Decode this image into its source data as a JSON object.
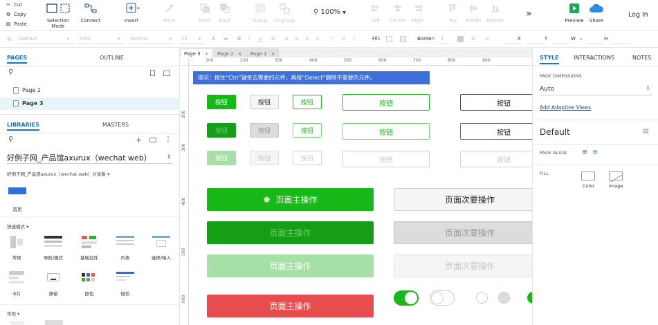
{
  "toolbar": {
    "cut": "Cut",
    "copy": "Copy",
    "paste": "Paste",
    "selection_mode": "Selection Mode",
    "connect": "Connect",
    "insert": "Insert",
    "point": "Point",
    "front": "Front",
    "back": "Back",
    "group": "Group",
    "ungroup": "Ungroup",
    "zoom": "100%",
    "left": "Left",
    "center": "Center",
    "right": "Right",
    "top": "Top",
    "middle": "Middle",
    "bottom": "Bottom",
    "more": "»",
    "preview": "Preview",
    "share": "Share",
    "login": "Log In"
  },
  "format_bar": {
    "style": "Default",
    "font": "Arial",
    "weight": "Normal",
    "size": "13",
    "fill_label": "Fill:",
    "border_label": "Border:",
    "border_value": "1",
    "x_label": "X",
    "y_label": "Y",
    "w_label": "W",
    "h_label": "H"
  },
  "left_panel": {
    "tabs": {
      "pages": "PAGES",
      "outline": "OUTLINE"
    },
    "pages": [
      "Page 2",
      "Page 3"
    ],
    "lib_tabs": {
      "libraries": "LIBRARIES",
      "masters": "MASTERS"
    },
    "library_select": "好例子网_产品馆axurux（wechat web）",
    "library_sub": "好例子网_产品馆axurux（wechat web）分享版",
    "first_item": "首页",
    "group1": "快速模式",
    "items": [
      "常规",
      "导航/模式",
      "基础控件",
      "列表",
      "选择/输入",
      "卡片",
      "弹窗",
      "颜色",
      "微信"
    ],
    "group2": "常规"
  },
  "canvas": {
    "tabs": [
      "Page 3",
      "Page 2",
      "Page 1"
    ],
    "ruler_top": [
      "100",
      "200",
      "300",
      "400",
      "500",
      "600",
      "700",
      "800",
      "900"
    ],
    "ruler_left": [
      "200",
      "300",
      "400",
      "500",
      "600"
    ],
    "tip": "提示：按住“Ctrl”键单击需要的元件，再按“Delect”删除不需要的元件。",
    "btn": "按钮",
    "primary": "页面主操作",
    "secondary": "页面次要操作"
  },
  "right_panel": {
    "tabs": {
      "style": "STYLE",
      "interactions": "INTERACTIONS",
      "notes": "NOTES"
    },
    "page_dimensions": "PAGE DIMENSIONS",
    "auto": "Auto",
    "adaptive": "Add Adaptive Views",
    "default": "Default",
    "page_align": "PAGE ALIGN",
    "fill": "FILL",
    "color": "Color",
    "image": "Image"
  },
  "colors": {
    "accent": "#1a73c7",
    "green": "#18b818",
    "red": "#e84d4d",
    "tip": "#3f6fd8"
  }
}
